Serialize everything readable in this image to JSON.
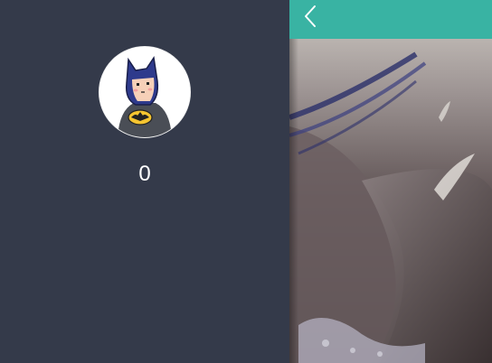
{
  "drawer": {
    "count_value": "0",
    "avatar_icon": "batman-avatar-icon"
  },
  "header": {
    "back_icon": "chevron-left-icon"
  },
  "colors": {
    "drawer_bg": "#343a4a",
    "header_bg": "#39b3a3",
    "text": "#ffffff"
  }
}
